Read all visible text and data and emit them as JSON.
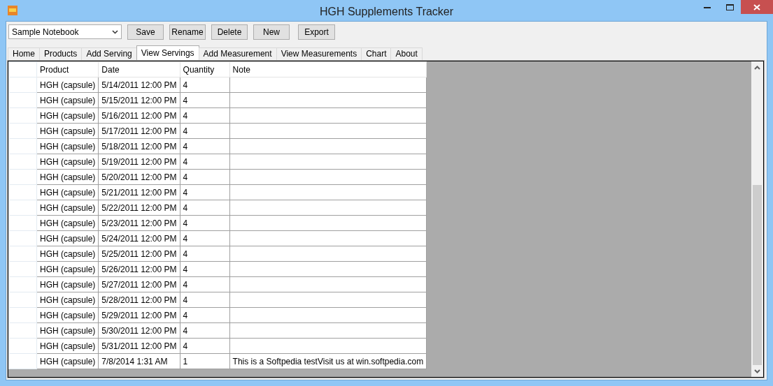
{
  "window": {
    "title": "HGH Supplements Tracker"
  },
  "toolbar": {
    "notebook": "Sample Notebook",
    "buttons": [
      "Save",
      "Rename",
      "Delete",
      "New",
      "Export"
    ]
  },
  "tabs": [
    {
      "label": "Home",
      "selected": false
    },
    {
      "label": "Products",
      "selected": false
    },
    {
      "label": "Add Serving",
      "selected": false
    },
    {
      "label": "View Servings",
      "selected": true
    },
    {
      "label": "Add Measurement",
      "selected": false
    },
    {
      "label": "View Measurements",
      "selected": false
    },
    {
      "label": "Chart",
      "selected": false
    },
    {
      "label": "About",
      "selected": false
    }
  ],
  "table": {
    "columns": [
      "Product",
      "Date",
      "Quantity",
      "Note"
    ],
    "rows": [
      [
        "HGH (capsule)",
        "5/14/2011 12:00 PM",
        "4",
        ""
      ],
      [
        "HGH (capsule)",
        "5/15/2011 12:00 PM",
        "4",
        ""
      ],
      [
        "HGH (capsule)",
        "5/16/2011 12:00 PM",
        "4",
        ""
      ],
      [
        "HGH (capsule)",
        "5/17/2011 12:00 PM",
        "4",
        ""
      ],
      [
        "HGH (capsule)",
        "5/18/2011 12:00 PM",
        "4",
        ""
      ],
      [
        "HGH (capsule)",
        "5/19/2011 12:00 PM",
        "4",
        ""
      ],
      [
        "HGH (capsule)",
        "5/20/2011 12:00 PM",
        "4",
        ""
      ],
      [
        "HGH (capsule)",
        "5/21/2011 12:00 PM",
        "4",
        ""
      ],
      [
        "HGH (capsule)",
        "5/22/2011 12:00 PM",
        "4",
        ""
      ],
      [
        "HGH (capsule)",
        "5/23/2011 12:00 PM",
        "4",
        ""
      ],
      [
        "HGH (capsule)",
        "5/24/2011 12:00 PM",
        "4",
        ""
      ],
      [
        "HGH (capsule)",
        "5/25/2011 12:00 PM",
        "4",
        ""
      ],
      [
        "HGH (capsule)",
        "5/26/2011 12:00 PM",
        "4",
        ""
      ],
      [
        "HGH (capsule)",
        "5/27/2011 12:00 PM",
        "4",
        ""
      ],
      [
        "HGH (capsule)",
        "5/28/2011 12:00 PM",
        "4",
        ""
      ],
      [
        "HGH (capsule)",
        "5/29/2011 12:00 PM",
        "4",
        ""
      ],
      [
        "HGH (capsule)",
        "5/30/2011 12:00 PM",
        "4",
        ""
      ],
      [
        "HGH (capsule)",
        "5/31/2011 12:00 PM",
        "4",
        ""
      ],
      [
        "HGH (capsule)",
        "7/8/2014 1:31 AM",
        "1",
        "This is a Softpedia testVisit us at win.softpedia.com"
      ]
    ]
  }
}
